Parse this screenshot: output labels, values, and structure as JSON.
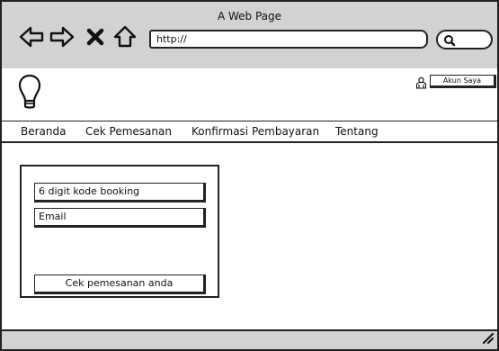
{
  "window": {
    "title": "A Web Page"
  },
  "addressbar": {
    "url": "http://"
  },
  "header": {
    "account_label": "Akun Saya"
  },
  "menu": {
    "items": [
      {
        "label": "Beranda"
      },
      {
        "label": "Cek Pemesanan"
      },
      {
        "label": "Konfirmasi Pembayaran"
      },
      {
        "label": "Tentang"
      }
    ]
  },
  "form": {
    "booking_placeholder": "6 digit kode booking",
    "email_placeholder": "Email",
    "submit_label": "Cek pemesanan anda"
  },
  "icons": {
    "back": "left-arrow-icon",
    "forward": "right-arrow-icon",
    "stop": "close-icon",
    "home": "home-icon",
    "search": "search-icon",
    "logo": "lightbulb-icon",
    "user": "user-icon",
    "resize": "resize-grip-icon"
  }
}
